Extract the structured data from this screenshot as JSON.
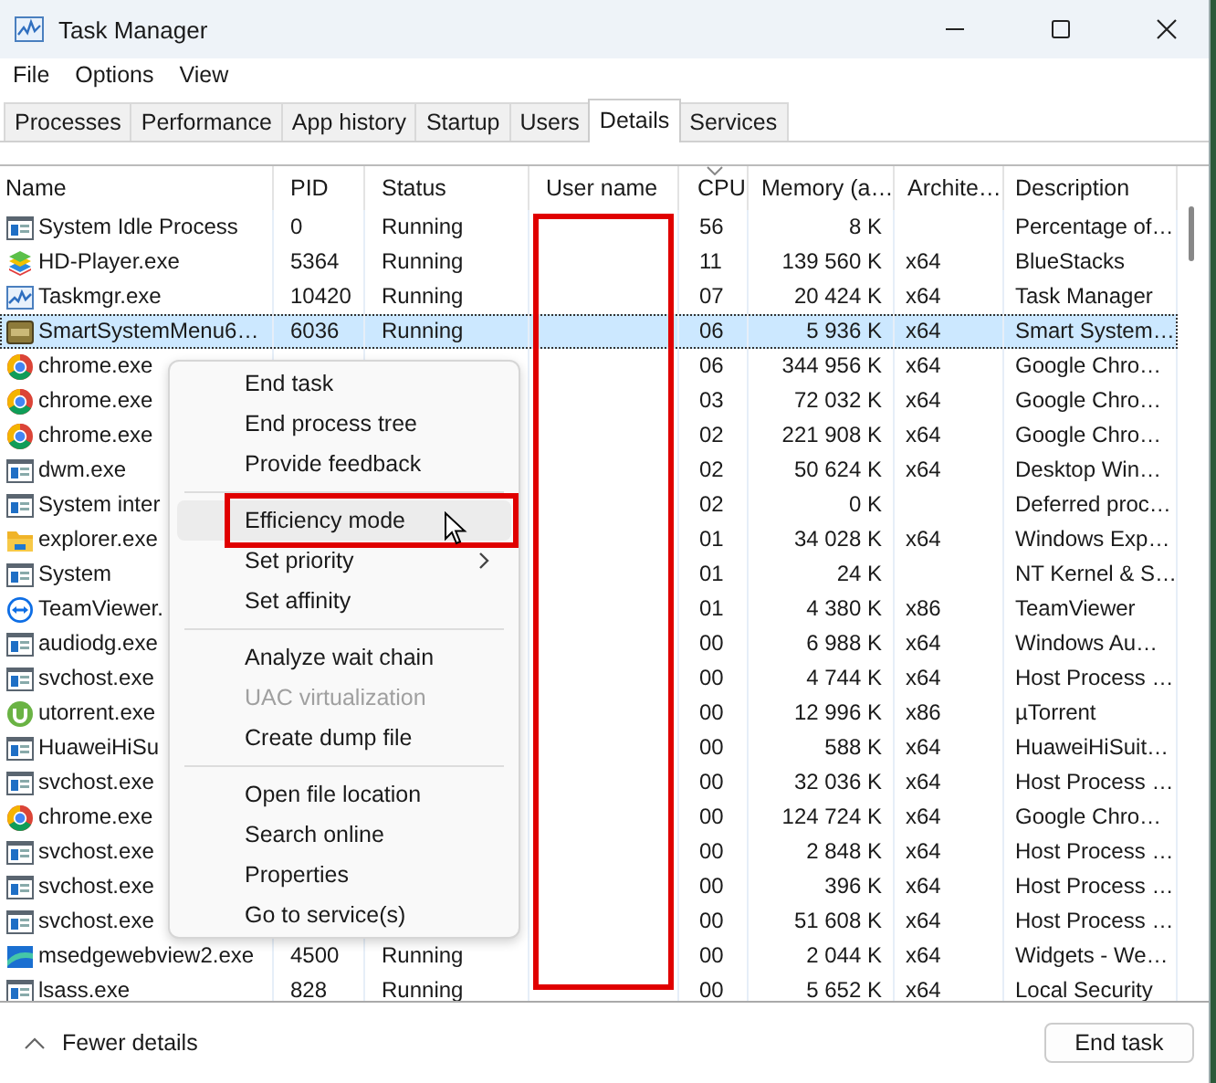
{
  "window": {
    "title": "Task Manager"
  },
  "menu_bar": [
    "File",
    "Options",
    "View"
  ],
  "tabs": [
    {
      "label": "Processes",
      "selected": false
    },
    {
      "label": "Performance",
      "selected": false
    },
    {
      "label": "App history",
      "selected": false
    },
    {
      "label": "Startup",
      "selected": false
    },
    {
      "label": "Users",
      "selected": false
    },
    {
      "label": "Details",
      "selected": true
    },
    {
      "label": "Services",
      "selected": false
    }
  ],
  "table": {
    "columns": [
      {
        "label": "Name",
        "sorted": false
      },
      {
        "label": "PID",
        "sorted": false
      },
      {
        "label": "Status",
        "sorted": false
      },
      {
        "label": "User name",
        "sorted": false,
        "redacted": true
      },
      {
        "label": "CPU",
        "sorted": true
      },
      {
        "label": "Memory (a…",
        "sorted": false
      },
      {
        "label": "Archite…",
        "sorted": false
      },
      {
        "label": "Description",
        "sorted": false
      }
    ],
    "rows": [
      {
        "kind": "window",
        "name": "System Idle Process",
        "pid": "0",
        "status": "Running",
        "cpu": "56",
        "memory": "8 K",
        "description": "Percentage of…",
        "selected": false
      },
      {
        "kind": "stack",
        "name": "HD-Player.exe",
        "pid": "5364",
        "status": "Running",
        "cpu": "11",
        "memory": "139 560 K",
        "arch": "x64",
        "description": "BlueStacks",
        "selected": false
      },
      {
        "kind": "graph",
        "name": "Taskmgr.exe",
        "pid": "10420",
        "status": "Running",
        "cpu": "07",
        "memory": "20 424 K",
        "arch": "x64",
        "description": "Task Manager",
        "selected": false
      },
      {
        "kind": "tile",
        "name": "SmartSystemMenu6…",
        "pid": "6036",
        "status": "Running",
        "cpu": "06",
        "memory": "5 936 K",
        "arch": "x64",
        "description": "Smart System…",
        "selected": true
      },
      {
        "kind": "ring",
        "name": "chrome.exe",
        "cpu": "06",
        "memory": "344 956 K",
        "arch": "x64",
        "description": "Google Chro…",
        "selected": false
      },
      {
        "kind": "ring",
        "name": "chrome.exe",
        "cpu": "03",
        "memory": "72 032 K",
        "arch": "x64",
        "description": "Google Chro…",
        "selected": false
      },
      {
        "kind": "ring",
        "name": "chrome.exe",
        "cpu": "02",
        "memory": "221 908 K",
        "arch": "x64",
        "description": "Google Chro…",
        "selected": false
      },
      {
        "kind": "window",
        "name": "dwm.exe",
        "cpu": "02",
        "memory": "50 624 K",
        "arch": "x64",
        "description": "Desktop Win…",
        "selected": false
      },
      {
        "kind": "window",
        "name": "System inter",
        "cpu": "02",
        "memory": "0 K",
        "description": "Deferred proc…",
        "selected": false
      },
      {
        "kind": "folder",
        "name": "explorer.exe",
        "cpu": "01",
        "memory": "34 028 K",
        "arch": "x64",
        "description": "Windows Exp…",
        "selected": false
      },
      {
        "kind": "window",
        "name": "System",
        "cpu": "01",
        "memory": "24 K",
        "description": "NT Kernel & S…",
        "selected": false
      },
      {
        "kind": "arrows",
        "name": "TeamViewer.",
        "cpu": "01",
        "memory": "4 380 K",
        "arch": "x86",
        "description": "TeamViewer",
        "selected": false
      },
      {
        "kind": "window",
        "name": "audiodg.exe",
        "cpu": "00",
        "memory": "6 988 K",
        "arch": "x64",
        "description": "Windows Au…",
        "selected": false
      },
      {
        "kind": "window",
        "name": "svchost.exe",
        "cpu": "00",
        "memory": "4 744 K",
        "arch": "x64",
        "description": "Host Process …",
        "selected": false
      },
      {
        "kind": "green",
        "name": "utorrent.exe",
        "cpu": "00",
        "memory": "12 996 K",
        "arch": "x86",
        "description": "µTorrent",
        "selected": false
      },
      {
        "kind": "window",
        "name": "HuaweiHiSu",
        "cpu": "00",
        "memory": "588 K",
        "arch": "x64",
        "description": "HuaweiHiSuit…",
        "selected": false
      },
      {
        "kind": "window",
        "name": "svchost.exe",
        "cpu": "00",
        "memory": "32 036 K",
        "arch": "x64",
        "description": "Host Process …",
        "selected": false
      },
      {
        "kind": "ring",
        "name": "chrome.exe",
        "cpu": "00",
        "memory": "124 724 K",
        "arch": "x64",
        "description": "Google Chro…",
        "selected": false
      },
      {
        "kind": "window",
        "name": "svchost.exe",
        "cpu": "00",
        "memory": "2 848 K",
        "arch": "x64",
        "description": "Host Process …",
        "selected": false
      },
      {
        "kind": "window",
        "name": "svchost.exe",
        "cpu": "00",
        "memory": "396 K",
        "arch": "x64",
        "description": "Host Process …",
        "selected": false
      },
      {
        "kind": "window",
        "name": "svchost.exe",
        "cpu": "00",
        "memory": "51 608 K",
        "arch": "x64",
        "description": "Host Process …",
        "selected": false
      },
      {
        "kind": "wave",
        "name": "msedgewebview2.exe",
        "pid": "4500",
        "status": "Running",
        "cpu": "00",
        "memory": "2 044 K",
        "arch": "x64",
        "description": "Widgets - We…",
        "selected": false
      },
      {
        "kind": "window",
        "name": "lsass.exe",
        "pid": "828",
        "status": "Running",
        "cpu": "00",
        "memory": "5 652 K",
        "arch": "x64",
        "description": "Local Security",
        "selected": false
      }
    ]
  },
  "context_menu": [
    {
      "kind": "item",
      "label": "End task",
      "disabled": false,
      "highlighted": false
    },
    {
      "kind": "item",
      "label": "End process tree",
      "disabled": false,
      "highlighted": false
    },
    {
      "kind": "item",
      "label": "Provide feedback",
      "disabled": false,
      "highlighted": false
    },
    {
      "kind": "separator"
    },
    {
      "kind": "item",
      "label": "Efficiency mode",
      "disabled": false,
      "highlighted": true
    },
    {
      "kind": "submenu",
      "label": "Set priority",
      "disabled": false,
      "highlighted": false
    },
    {
      "kind": "item",
      "label": "Set affinity",
      "disabled": false,
      "highlighted": false
    },
    {
      "kind": "separator"
    },
    {
      "kind": "item",
      "label": "Analyze wait chain",
      "disabled": false,
      "highlighted": false
    },
    {
      "kind": "item",
      "label": "UAC virtualization",
      "disabled": true,
      "highlighted": false
    },
    {
      "kind": "item",
      "label": "Create dump file",
      "disabled": false,
      "highlighted": false
    },
    {
      "kind": "separator"
    },
    {
      "kind": "item",
      "label": "Open file location",
      "disabled": false,
      "highlighted": false
    },
    {
      "kind": "item",
      "label": "Search online",
      "disabled": false,
      "highlighted": false
    },
    {
      "kind": "item",
      "label": "Properties",
      "disabled": false,
      "highlighted": false
    },
    {
      "kind": "item",
      "label": "Go to service(s)",
      "disabled": false,
      "highlighted": false
    }
  ],
  "footer": {
    "toggle": "Fewer details",
    "button": "End task"
  }
}
